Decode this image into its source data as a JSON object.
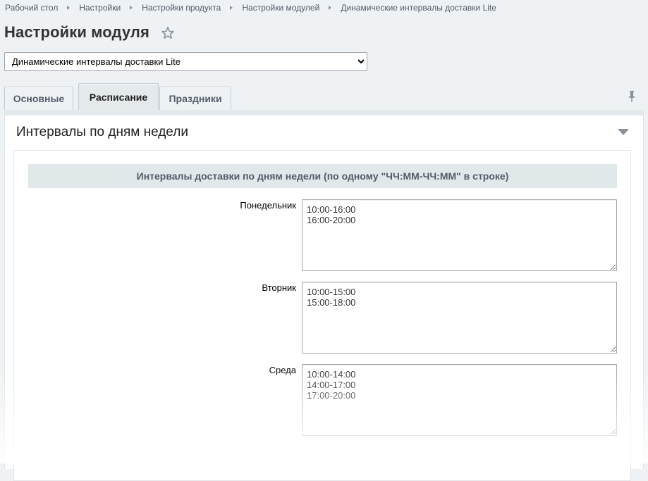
{
  "breadcrumb": [
    "Рабочий стол",
    "Настройки",
    "Настройки продукта",
    "Настройки модулей",
    "Динамические интервалы доставки Lite"
  ],
  "page": {
    "title": "Настройки модуля"
  },
  "module_select": {
    "value": "Динамические интервалы доставки Lite",
    "options": [
      "Динамические интервалы доставки Lite"
    ]
  },
  "tabs": [
    {
      "label": "Основные",
      "active": false
    },
    {
      "label": "Расписание",
      "active": true
    },
    {
      "label": "Праздники",
      "active": false
    }
  ],
  "section": {
    "title": "Интервалы по дням недели",
    "group_header": "Интервалы доставки по дням недели (по одному \"ЧЧ:ММ-ЧЧ:ММ\" в строке)",
    "fields": [
      {
        "label": "Понедельник",
        "value": "10:00-16:00\n16:00-20:00"
      },
      {
        "label": "Вторник",
        "value": "10:00-15:00\n15:00-18:00"
      },
      {
        "label": "Среда",
        "value": "10:00-14:00\n14:00-17:00\n17:00-20:00"
      }
    ]
  },
  "icons": {
    "favorite": "star-icon",
    "pin": "pin-icon",
    "collapse": "triangle-down-icon"
  },
  "colors": {
    "background": "#eef2f4",
    "tab_active": "#e4e9ec",
    "group_header_bg": "#e0e8ea",
    "text_muted": "#535c69"
  }
}
